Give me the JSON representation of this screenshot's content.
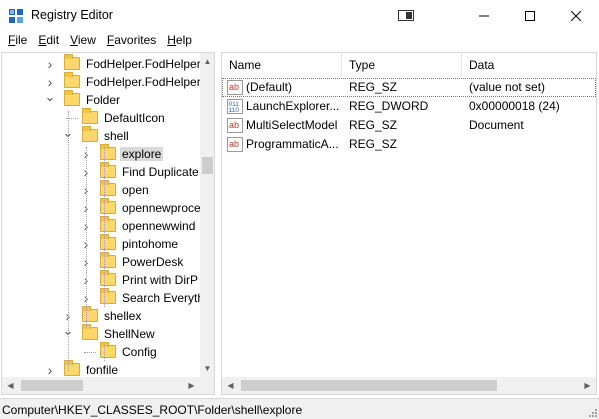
{
  "window": {
    "title": "Registry Editor"
  },
  "menu": [
    {
      "first": "F",
      "rest": "ile"
    },
    {
      "first": "E",
      "rest": "dit"
    },
    {
      "first": "V",
      "rest": "iew"
    },
    {
      "first": "F",
      "rest": "avorites"
    },
    {
      "first": "H",
      "rest": "elp"
    }
  ],
  "tree": [
    {
      "label": "FodHelper.FodHelper",
      "expander": "collapsed",
      "level": 0,
      "selected": false
    },
    {
      "label": "FodHelper.FodHelper",
      "expander": "collapsed",
      "level": 0,
      "selected": false
    },
    {
      "label": "Folder",
      "expander": "expanded",
      "level": 0,
      "selected": false
    },
    {
      "label": "DefaultIcon",
      "expander": "none",
      "level": 1,
      "selected": false
    },
    {
      "label": "shell",
      "expander": "expanded",
      "level": 1,
      "selected": false
    },
    {
      "label": "explore",
      "expander": "collapsed",
      "level": 2,
      "selected": true
    },
    {
      "label": "Find Duplicate",
      "expander": "collapsed",
      "level": 2,
      "selected": false
    },
    {
      "label": "open",
      "expander": "collapsed",
      "level": 2,
      "selected": false
    },
    {
      "label": "opennewproce",
      "expander": "collapsed",
      "level": 2,
      "selected": false
    },
    {
      "label": "opennewwind",
      "expander": "collapsed",
      "level": 2,
      "selected": false
    },
    {
      "label": "pintohome",
      "expander": "collapsed",
      "level": 2,
      "selected": false
    },
    {
      "label": "PowerDesk",
      "expander": "collapsed",
      "level": 2,
      "selected": false
    },
    {
      "label": "Print with DirP",
      "expander": "collapsed",
      "level": 2,
      "selected": false
    },
    {
      "label": "Search Everyth",
      "expander": "collapsed",
      "level": 2,
      "selected": false
    },
    {
      "label": "shellex",
      "expander": "collapsed",
      "level": 1,
      "selected": false
    },
    {
      "label": "ShellNew",
      "expander": "expanded",
      "level": 1,
      "selected": false
    },
    {
      "label": "Config",
      "expander": "none",
      "level": 2,
      "selected": false
    },
    {
      "label": "fonfile",
      "expander": "collapsed",
      "level": 0,
      "selected": false
    }
  ],
  "list": {
    "columns": [
      "Name",
      "Type",
      "Data"
    ],
    "rows": [
      {
        "icon": "string-value-icon",
        "name": "(Default)",
        "type": "REG_SZ",
        "data": "(value not set)",
        "focused": true
      },
      {
        "icon": "binary-value-icon",
        "name": "LaunchExplorer...",
        "type": "REG_DWORD",
        "data": "0x00000018 (24)",
        "focused": false
      },
      {
        "icon": "string-value-icon",
        "name": "MultiSelectModel",
        "type": "REG_SZ",
        "data": "Document",
        "focused": false
      },
      {
        "icon": "string-value-icon",
        "name": "ProgrammaticA...",
        "type": "REG_SZ",
        "data": "",
        "focused": false
      }
    ]
  },
  "status": {
    "path": "Computer\\HKEY_CLASSES_ROOT\\Folder\\shell\\explore"
  },
  "colors": {
    "folder": "#fcd86a",
    "selection": "#d9d9d9",
    "scrollbar": "#f0f0f0",
    "registry_icon_blue": "#1e64c8",
    "string_icon_red": "#c0392b"
  }
}
